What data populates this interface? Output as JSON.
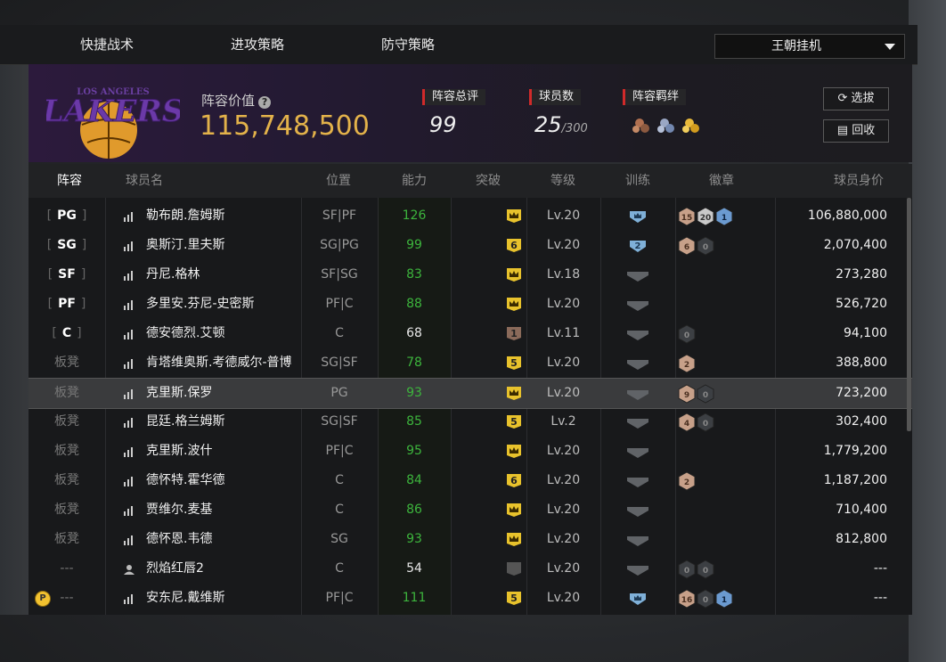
{
  "tabs": [
    "快捷战术",
    "进攻策略",
    "防守策略"
  ],
  "dropdown": {
    "value": "王朝挂机"
  },
  "team": {
    "value_label": "阵容价值",
    "value": "115,748,500",
    "rating_label": "阵容总评",
    "rating": "99",
    "players_label": "球员数",
    "players": "25",
    "players_max": "/300",
    "bond_label": "阵容羁绊",
    "logo_text": "LAKERS",
    "logo_subtext": "LOS ANGELES"
  },
  "buttons": {
    "scout": "选拔",
    "recycle": "回收"
  },
  "columns": [
    "阵容",
    "球员名",
    "位置",
    "能力",
    "突破",
    "等级",
    "训练",
    "徽章",
    "球员身价"
  ],
  "rows": [
    {
      "slot": "PG",
      "name": "勒布朗.詹姆斯",
      "pos": "SF|PF",
      "ability": "126",
      "breakthrough": "crown",
      "level": "Lv.20",
      "training": "crown-blue",
      "badges": [
        "15",
        "20",
        "1"
      ],
      "price": "106,880,000"
    },
    {
      "slot": "SG",
      "name": "奥斯汀.里夫斯",
      "pos": "SG|PG",
      "ability": "99",
      "breakthrough": "6",
      "level": "Lv.20",
      "training": "2",
      "badges": [
        "6",
        "0"
      ],
      "price": "2,070,400"
    },
    {
      "slot": "SF",
      "name": "丹尼.格林",
      "pos": "SF|SG",
      "ability": "83",
      "breakthrough": "crown",
      "level": "Lv.18",
      "training": "empty",
      "badges": [],
      "price": "273,280"
    },
    {
      "slot": "PF",
      "name": "多里安.芬尼-史密斯",
      "pos": "PF|C",
      "ability": "88",
      "breakthrough": "crown",
      "level": "Lv.20",
      "training": "empty",
      "badges": [],
      "price": "526,720"
    },
    {
      "slot": "C",
      "name": "德安德烈.艾顿",
      "pos": "C",
      "ability": "68",
      "breakthrough": "1",
      "level": "Lv.11",
      "training": "empty",
      "badges": [
        "0"
      ],
      "price": "94,100"
    },
    {
      "slot": "板凳",
      "name": "肯塔维奥斯.考德威尔-普博",
      "pos": "SG|SF",
      "ability": "78",
      "breakthrough": "5",
      "level": "Lv.20",
      "training": "empty",
      "badges": [
        "2"
      ],
      "price": "388,800"
    },
    {
      "slot": "板凳",
      "name": "克里斯.保罗",
      "pos": "PG",
      "ability": "93",
      "breakthrough": "crown",
      "level": "Lv.20",
      "training": "empty",
      "badges": [
        "9",
        "0"
      ],
      "price": "723,200"
    },
    {
      "slot": "板凳",
      "name": "昆廷.格兰姆斯",
      "pos": "SG|SF",
      "ability": "85",
      "breakthrough": "5",
      "level": "Lv.2",
      "training": "empty",
      "badges": [
        "4",
        "0"
      ],
      "price": "302,400"
    },
    {
      "slot": "板凳",
      "name": "克里斯.波什",
      "pos": "PF|C",
      "ability": "95",
      "breakthrough": "crown",
      "level": "Lv.20",
      "training": "empty",
      "badges": [],
      "price": "1,779,200"
    },
    {
      "slot": "板凳",
      "name": "德怀特.霍华德",
      "pos": "C",
      "ability": "84",
      "breakthrough": "6",
      "level": "Lv.20",
      "training": "empty",
      "badges": [
        "2"
      ],
      "price": "1,187,200"
    },
    {
      "slot": "板凳",
      "name": "贾维尔.麦基",
      "pos": "C",
      "ability": "86",
      "breakthrough": "crown",
      "level": "Lv.20",
      "training": "empty",
      "badges": [],
      "price": "710,400"
    },
    {
      "slot": "板凳",
      "name": "德怀恩.韦德",
      "pos": "SG",
      "ability": "93",
      "breakthrough": "crown",
      "level": "Lv.20",
      "training": "empty",
      "badges": [],
      "price": "812,800"
    },
    {
      "slot": "---",
      "name": "烈焰红唇2",
      "pos": "C",
      "ability": "54",
      "breakthrough": "none",
      "level": "Lv.20",
      "training": "empty",
      "badges": [
        "0",
        "0"
      ],
      "price": "---",
      "is_user": true
    },
    {
      "slot": "---",
      "name": "安东尼.戴维斯",
      "pos": "PF|C",
      "ability": "111",
      "breakthrough": "5",
      "level": "Lv.20",
      "training": "crown-blue",
      "badges": [
        "16",
        "0",
        "1"
      ],
      "price": "---",
      "p_coin": "P"
    }
  ],
  "colors": {
    "gold": "#e3b24a",
    "green": "#3db53d",
    "red": "#d02a2a",
    "panel": "#18191b"
  }
}
